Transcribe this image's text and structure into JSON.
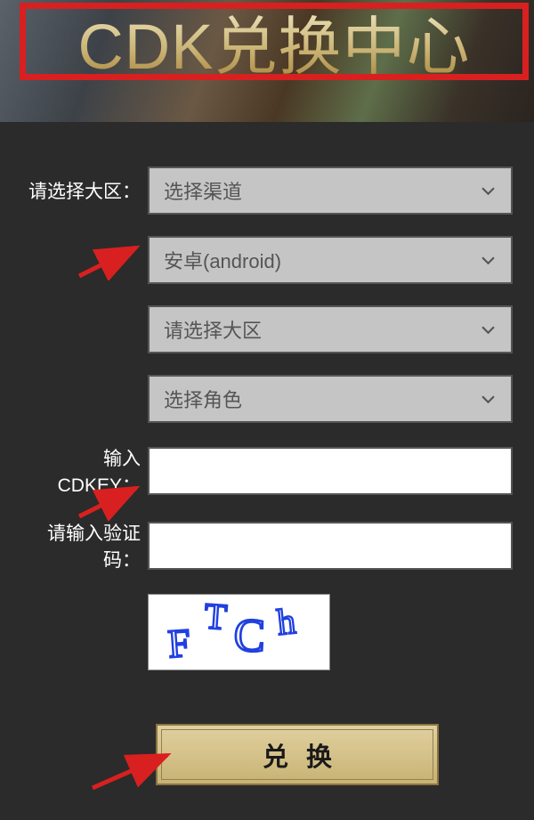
{
  "banner": {
    "title": "CDK兑换中心"
  },
  "form": {
    "region_label": "请选择大区：",
    "cdkey_label": "输入CDKEY：",
    "captcha_label": "请输入验证码：",
    "selects": {
      "channel": "选择渠道",
      "platform": "安卓(android)",
      "region": "请选择大区",
      "role": "选择角色"
    },
    "cdkey_value": "",
    "captcha_value": "",
    "captcha_text": "FTCh",
    "submit_label": "兑换"
  },
  "colors": {
    "highlight_red": "#d82020",
    "button_gold": "#d5c28a",
    "background": "#2b2b2b"
  }
}
